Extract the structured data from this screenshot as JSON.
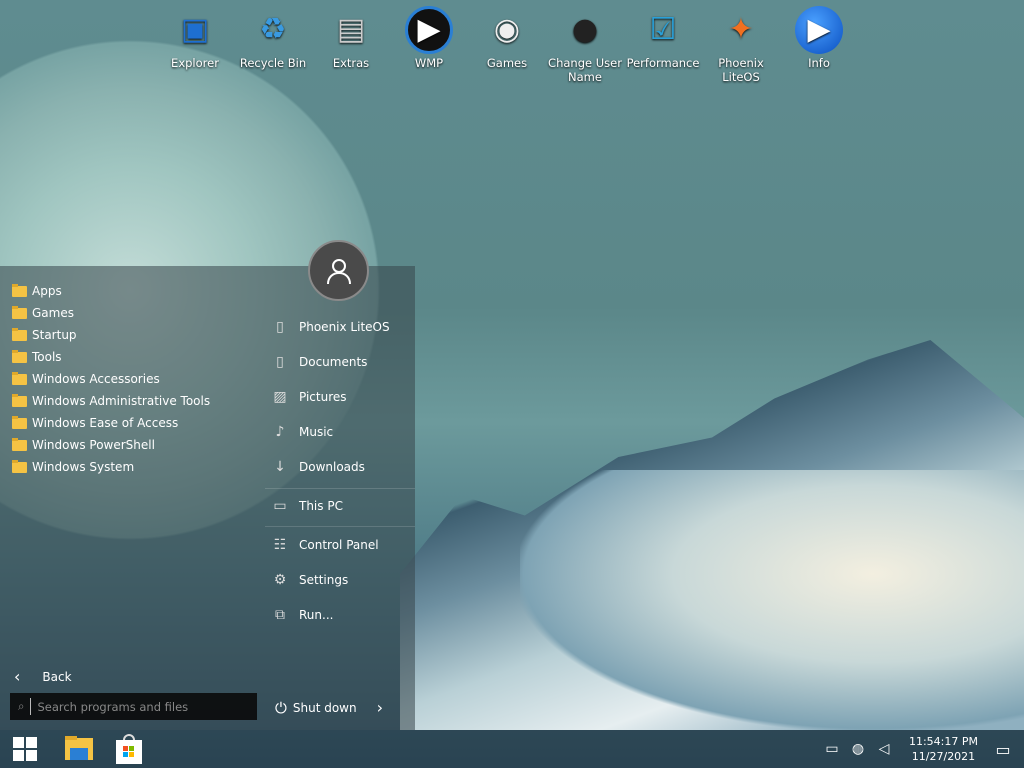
{
  "desktop_icons": [
    {
      "label": "Explorer",
      "icon": "monitor-icon"
    },
    {
      "label": "Recycle Bin",
      "icon": "recycle-bin-icon"
    },
    {
      "label": "Extras",
      "icon": "folder-icon"
    },
    {
      "label": "WMP",
      "icon": "media-player-icon"
    },
    {
      "label": "Games",
      "icon": "gamepad-icon"
    },
    {
      "label": "Change User Name",
      "icon": "users-icon"
    },
    {
      "label": "Performance",
      "icon": "performance-icon"
    },
    {
      "label": "Phoenix LiteOS",
      "icon": "phoenix-icon"
    },
    {
      "label": "Info",
      "icon": "info-play-icon"
    }
  ],
  "start_menu": {
    "folders": [
      "Apps",
      "Games",
      "Startup",
      "Tools",
      "Windows Accessories",
      "Windows Administrative Tools",
      "Windows Ease of Access",
      "Windows PowerShell",
      "Windows System"
    ],
    "right_items": [
      {
        "label": "Phoenix LiteOS",
        "icon": "user-folder-icon"
      },
      {
        "label": "Documents",
        "icon": "document-icon"
      },
      {
        "label": "Pictures",
        "icon": "picture-icon"
      },
      {
        "label": "Music",
        "icon": "music-icon"
      },
      {
        "label": "Downloads",
        "icon": "download-icon"
      },
      {
        "label": "This PC",
        "icon": "computer-icon"
      },
      {
        "label": "Control Panel",
        "icon": "control-panel-icon"
      },
      {
        "label": "Settings",
        "icon": "gear-icon"
      },
      {
        "label": "Run...",
        "icon": "run-icon"
      }
    ],
    "back_label": "Back",
    "search_placeholder": "Search programs and files",
    "shutdown_label": "Shut down"
  },
  "taskbar": {
    "time": "11:54:17 PM",
    "date": "11/27/2021"
  }
}
